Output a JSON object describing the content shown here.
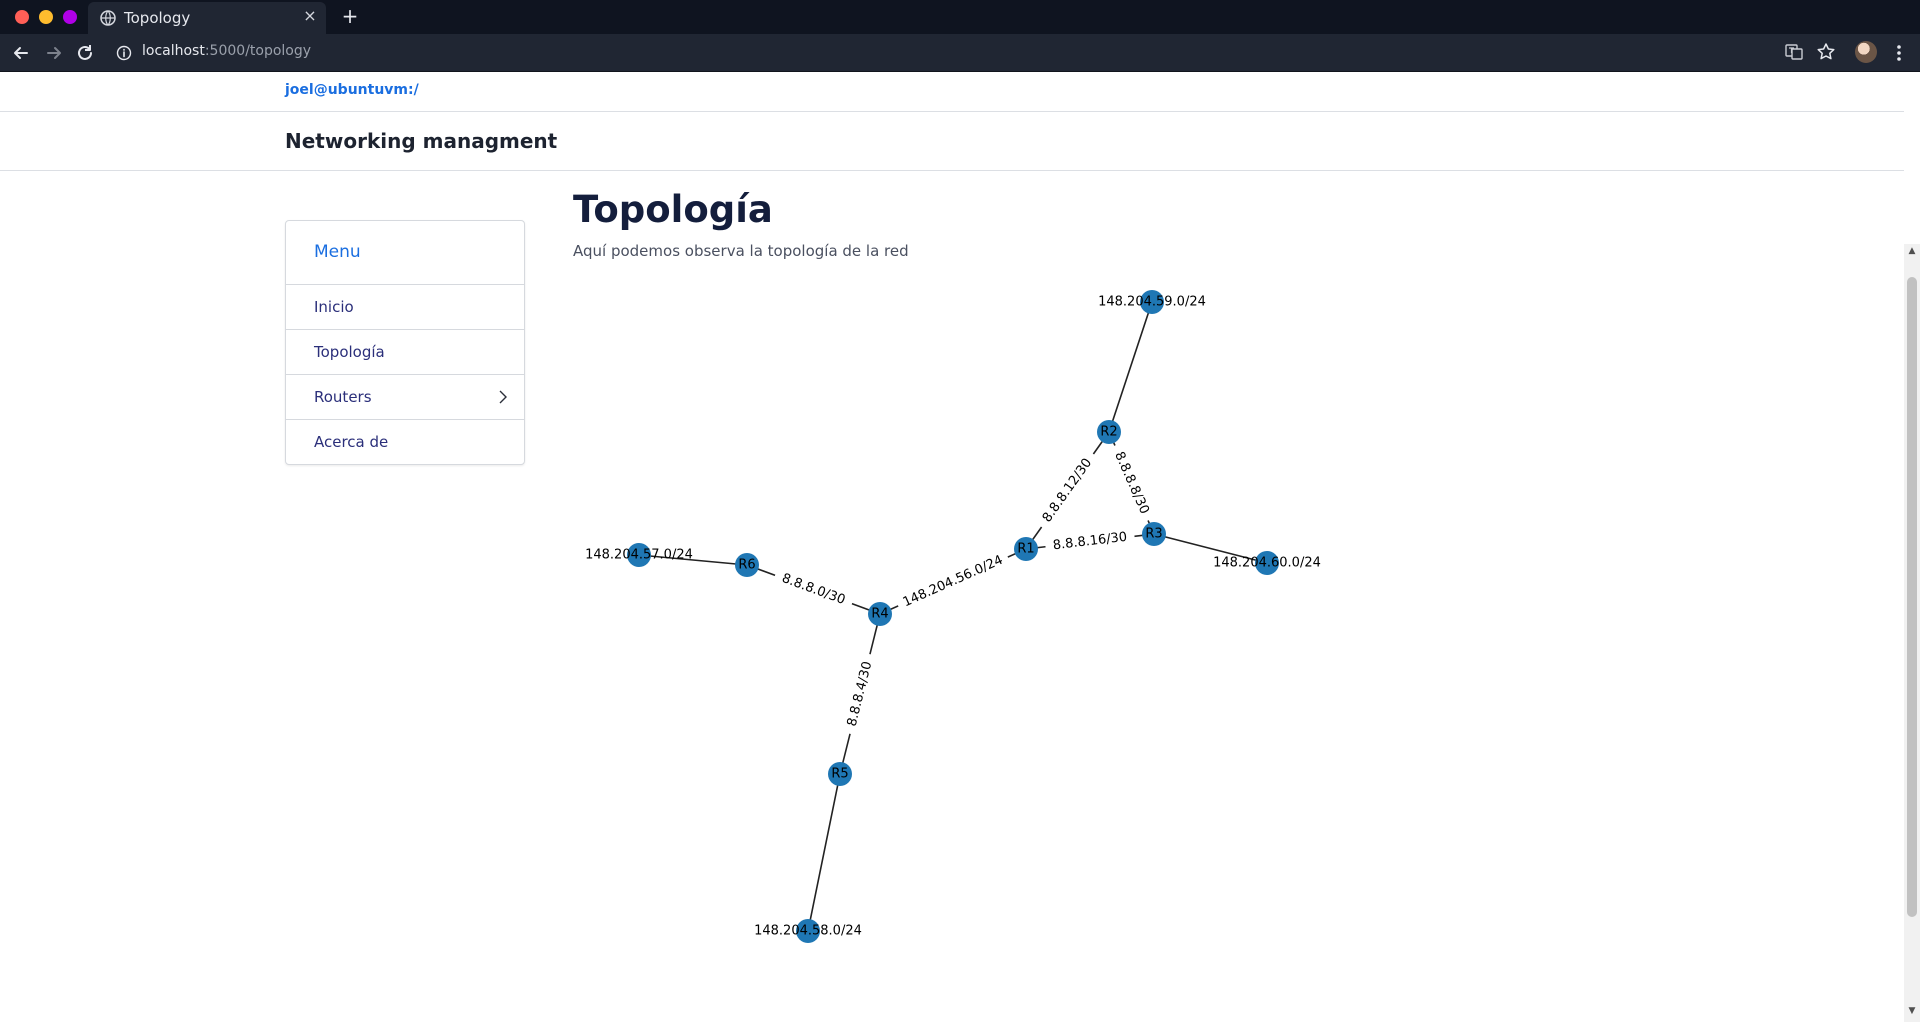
{
  "browser": {
    "tab_title": "Topology",
    "url_host": "localhost",
    "url_path": ":5000/topology"
  },
  "topbar": {
    "user": "joel@ubuntuvm:/"
  },
  "header": {
    "brand": "Networking managment"
  },
  "menu": {
    "title": "Menu",
    "items": [
      {
        "label": "Inicio"
      },
      {
        "label": "Topología"
      },
      {
        "label": "Routers"
      },
      {
        "label": "Acerca de"
      }
    ]
  },
  "main": {
    "title": "Topología",
    "subtitle": "Aquí podemos observa la topología de la red"
  },
  "graph": {
    "node_color": "#1f77b4",
    "nodes": [
      {
        "id": "R1",
        "label": "R1"
      },
      {
        "id": "R2",
        "label": "R2"
      },
      {
        "id": "R3",
        "label": "R3"
      },
      {
        "id": "R4",
        "label": "R4"
      },
      {
        "id": "R5",
        "label": "R5"
      },
      {
        "id": "R6",
        "label": "R6"
      },
      {
        "id": "N59",
        "label": "148.204.59.0/24"
      },
      {
        "id": "N60",
        "label": "148.204.60.0/24"
      },
      {
        "id": "N57",
        "label": "148.204.57.0/24"
      },
      {
        "id": "N58",
        "label": "148.204.58.0/24"
      }
    ],
    "edges": [
      {
        "from": "R2",
        "to": "N59",
        "label": ""
      },
      {
        "from": "R1",
        "to": "R2",
        "label": "8.8.8.12/30"
      },
      {
        "from": "R2",
        "to": "R3",
        "label": "8.8.8.8/30"
      },
      {
        "from": "R1",
        "to": "R3",
        "label": "8.8.8.16/30"
      },
      {
        "from": "R3",
        "to": "N60",
        "label": ""
      },
      {
        "from": "R1",
        "to": "R4",
        "label": "148.204.56.0/24"
      },
      {
        "from": "R6",
        "to": "R4",
        "label": "8.8.8.0/30"
      },
      {
        "from": "N57",
        "to": "R6",
        "label": ""
      },
      {
        "from": "R4",
        "to": "R5",
        "label": "8.8.8.4/30"
      },
      {
        "from": "R5",
        "to": "N58",
        "label": ""
      }
    ]
  }
}
